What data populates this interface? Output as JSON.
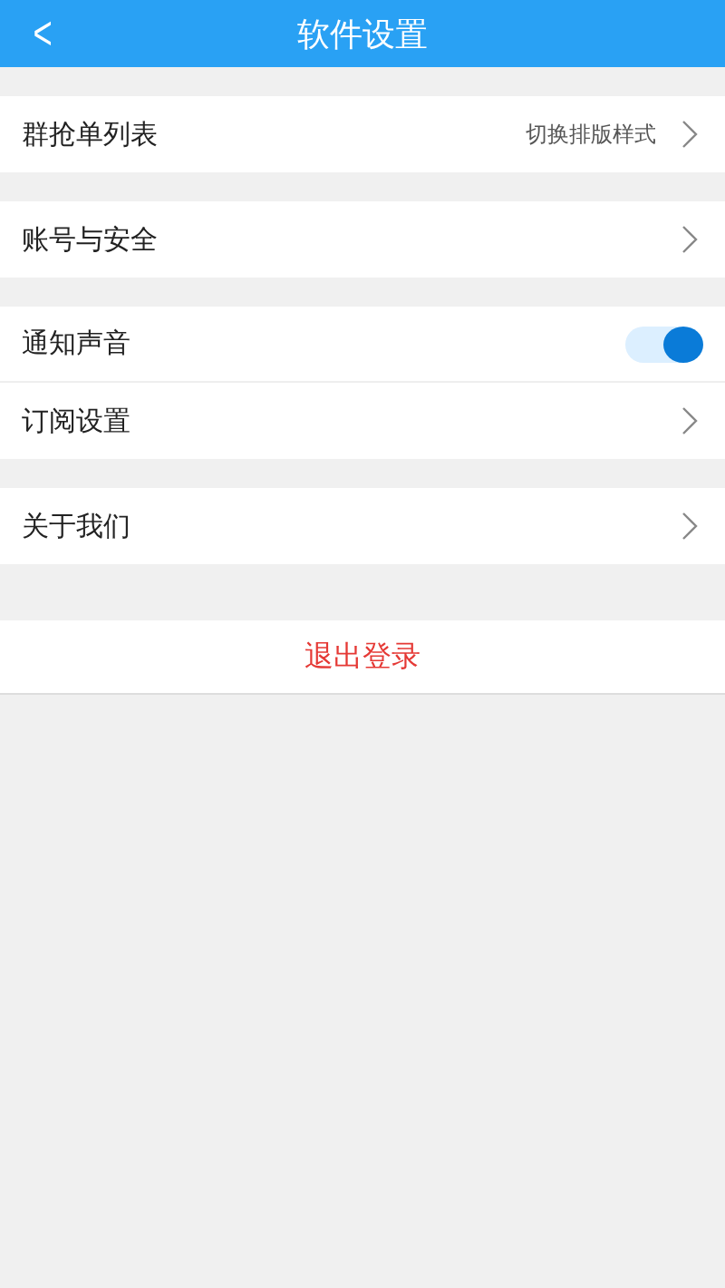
{
  "header": {
    "back": "<",
    "title": "软件设置"
  },
  "groups": [
    {
      "items": [
        {
          "kind": "link",
          "label": "群抢单列表",
          "value": "切换排版样式"
        }
      ]
    },
    {
      "items": [
        {
          "kind": "link",
          "label": "账号与安全"
        }
      ]
    },
    {
      "items": [
        {
          "kind": "toggle",
          "label": "通知声音",
          "on": true
        },
        {
          "kind": "link",
          "label": "订阅设置"
        }
      ]
    },
    {
      "items": [
        {
          "kind": "link",
          "label": "关于我们"
        }
      ]
    }
  ],
  "logout": "退出登录"
}
